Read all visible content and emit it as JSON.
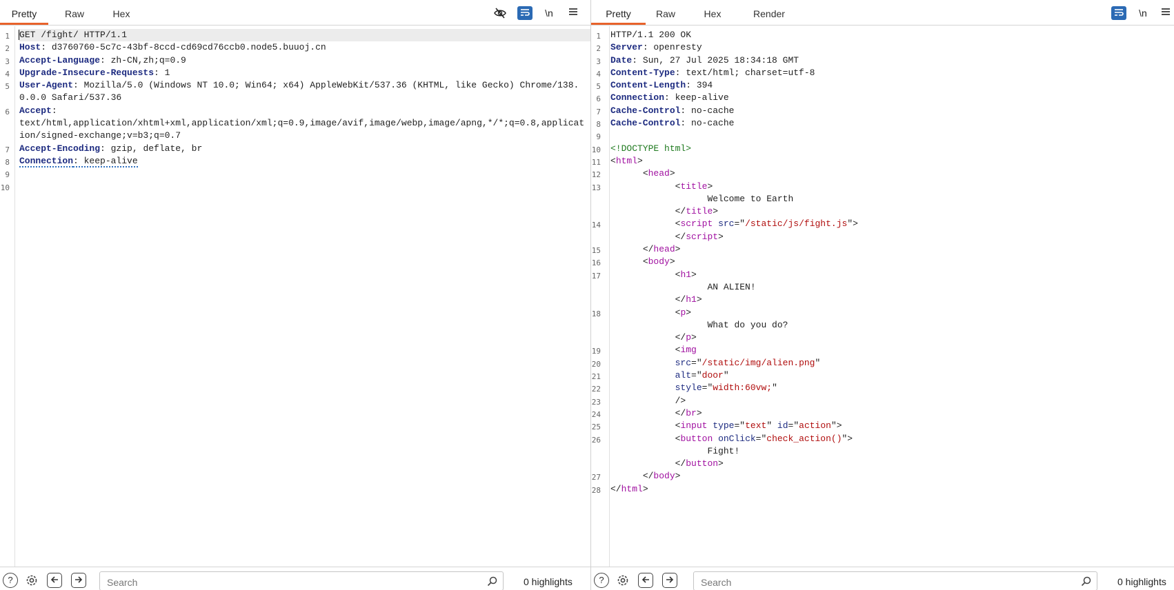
{
  "request_pane": {
    "tabs": [
      {
        "label": "Pretty",
        "active": true
      },
      {
        "label": "Raw",
        "active": false
      },
      {
        "label": "Hex",
        "active": false
      }
    ],
    "toolbar": {
      "hide_icon": "eye-slash-icon",
      "wrap_icon": "wrap-lines-icon",
      "newline_label": "\\n",
      "menu_icon": "hamburger-menu-icon"
    },
    "lines": [
      {
        "n": "1",
        "current": true,
        "tokens": [
          [
            "caret",
            "G"
          ],
          [
            "",
            "ET /fight/ HTTP/1.1"
          ]
        ]
      },
      {
        "n": "2",
        "tokens": [
          [
            "hk",
            "Host"
          ],
          [
            "",
            ": d3760760-5c7c-43bf-8ccd-cd69cd76ccb0.node5.buuoj.cn"
          ]
        ]
      },
      {
        "n": "3",
        "tokens": [
          [
            "hk",
            "Accept-Language"
          ],
          [
            "",
            ": zh-CN,zh;q=0.9"
          ]
        ]
      },
      {
        "n": "4",
        "tokens": [
          [
            "hk",
            "Upgrade-Insecure-Requests"
          ],
          [
            "",
            ": 1"
          ]
        ]
      },
      {
        "n": "5",
        "tokens": [
          [
            "hk",
            "User-Agent"
          ],
          [
            "",
            ": Mozilla/5.0 (Windows NT 10.0; Win64; x64) AppleWebKit/537.36 (KHTML, like Gecko) Chrome/138.0.0.0 Safari/537.36"
          ]
        ]
      },
      {
        "n": "6",
        "tokens": [
          [
            "hk",
            "Accept"
          ],
          [
            "",
            ":\ntext/html,application/xhtml+xml,application/xml;q=0.9,image/avif,image/webp,image/apng,*/*;q=0.8,application/signed-exchange;v=b3;q=0.7"
          ]
        ]
      },
      {
        "n": "7",
        "tokens": [
          [
            "hk",
            "Accept-Encoding"
          ],
          [
            "",
            ": gzip, deflate, br"
          ]
        ]
      },
      {
        "n": "8",
        "tokens": [
          [
            "hk dotted",
            "Connection"
          ],
          [
            "dotted",
            ": keep-alive"
          ]
        ]
      },
      {
        "n": "9",
        "tokens": [
          [
            "",
            ""
          ]
        ]
      },
      {
        "n": "10",
        "tokens": [
          [
            "",
            ""
          ]
        ]
      }
    ],
    "bottom": {
      "help_icon": "help-icon",
      "settings_icon": "gear-icon",
      "back_icon": "arrow-left-icon",
      "forward_icon": "arrow-right-icon",
      "search_placeholder": "Search",
      "search_icon": "search-icon",
      "highlights": "0 highlights"
    }
  },
  "response_pane": {
    "tabs": [
      {
        "label": "Pretty",
        "active": true
      },
      {
        "label": "Raw",
        "active": false
      },
      {
        "label": "Hex",
        "active": false
      },
      {
        "label": "Render",
        "active": false
      }
    ],
    "toolbar": {
      "wrap_icon": "wrap-lines-icon",
      "newline_label": "\\n",
      "menu_icon": "hamburger-menu-icon"
    },
    "lines": [
      {
        "n": "1",
        "tokens": [
          [
            "",
            "HTTP/1.1 200 OK"
          ]
        ]
      },
      {
        "n": "2",
        "tokens": [
          [
            "hk",
            "Server"
          ],
          [
            "",
            ": openresty"
          ]
        ]
      },
      {
        "n": "3",
        "tokens": [
          [
            "hk",
            "Date"
          ],
          [
            "",
            ": Sun, 27 Jul 2025 18:34:18 GMT"
          ]
        ]
      },
      {
        "n": "4",
        "tokens": [
          [
            "hk",
            "Content-Type"
          ],
          [
            "",
            ": text/html; charset=utf-8"
          ]
        ]
      },
      {
        "n": "5",
        "tokens": [
          [
            "hk",
            "Content-Length"
          ],
          [
            "",
            ": 394"
          ]
        ]
      },
      {
        "n": "6",
        "tokens": [
          [
            "hk",
            "Connection"
          ],
          [
            "",
            ": keep-alive"
          ]
        ]
      },
      {
        "n": "7",
        "tokens": [
          [
            "hk",
            "Cache-Control"
          ],
          [
            "",
            ": no-cache"
          ]
        ]
      },
      {
        "n": "8",
        "tokens": [
          [
            "hk",
            "Cache-Control"
          ],
          [
            "",
            ": no-cache"
          ]
        ]
      },
      {
        "n": "9",
        "tokens": [
          [
            "",
            ""
          ]
        ]
      },
      {
        "n": "10",
        "tokens": [
          [
            "dt",
            "<!DOCTYPE html>"
          ]
        ]
      },
      {
        "n": "11",
        "tokens": [
          [
            "",
            "<"
          ],
          [
            "tg",
            "html"
          ],
          [
            "",
            ">"
          ]
        ]
      },
      {
        "n": "12",
        "tokens": [
          [
            "",
            "      <"
          ],
          [
            "tg",
            "head"
          ],
          [
            "",
            ">"
          ]
        ]
      },
      {
        "n": "13",
        "tokens": [
          [
            "",
            "            <"
          ],
          [
            "tg",
            "title"
          ],
          [
            "",
            ">\n                  Welcome to Earth\n            </"
          ],
          [
            "tg",
            "title"
          ],
          [
            "",
            ">"
          ]
        ]
      },
      {
        "n": "14",
        "tokens": [
          [
            "",
            "            <"
          ],
          [
            "tg",
            "script"
          ],
          [
            "",
            " "
          ],
          [
            "at",
            "src"
          ],
          [
            "",
            "=\""
          ],
          [
            "av",
            "/static/js/fight.js"
          ],
          [
            "",
            "\">\n            </"
          ],
          [
            "tg",
            "script"
          ],
          [
            "",
            ">"
          ]
        ]
      },
      {
        "n": "15",
        "tokens": [
          [
            "",
            "      </"
          ],
          [
            "tg",
            "head"
          ],
          [
            "",
            ">"
          ]
        ]
      },
      {
        "n": "16",
        "tokens": [
          [
            "",
            "      <"
          ],
          [
            "tg",
            "body"
          ],
          [
            "",
            ">"
          ]
        ]
      },
      {
        "n": "17",
        "tokens": [
          [
            "",
            "            <"
          ],
          [
            "tg",
            "h1"
          ],
          [
            "",
            ">\n                  AN ALIEN!\n            </"
          ],
          [
            "tg",
            "h1"
          ],
          [
            "",
            ">"
          ]
        ]
      },
      {
        "n": "18",
        "tokens": [
          [
            "",
            "            <"
          ],
          [
            "tg",
            "p"
          ],
          [
            "",
            ">\n                  What do you do?\n            </"
          ],
          [
            "tg",
            "p"
          ],
          [
            "",
            ">"
          ]
        ]
      },
      {
        "n": "19",
        "tokens": [
          [
            "",
            "            <"
          ],
          [
            "tg",
            "img"
          ]
        ]
      },
      {
        "n": "20",
        "tokens": [
          [
            "at",
            "            src"
          ],
          [
            "",
            "=\""
          ],
          [
            "av",
            "/static/img/alien.png"
          ],
          [
            "",
            "\""
          ]
        ]
      },
      {
        "n": "21",
        "tokens": [
          [
            "at",
            "            alt"
          ],
          [
            "",
            "=\""
          ],
          [
            "av",
            "door"
          ],
          [
            "",
            "\""
          ]
        ]
      },
      {
        "n": "22",
        "tokens": [
          [
            "at",
            "            style"
          ],
          [
            "",
            "=\""
          ],
          [
            "av",
            "width:60vw;"
          ],
          [
            "",
            "\""
          ]
        ]
      },
      {
        "n": "23",
        "tokens": [
          [
            "",
            "            />"
          ]
        ]
      },
      {
        "n": "24",
        "tokens": [
          [
            "",
            "            </"
          ],
          [
            "tg",
            "br"
          ],
          [
            "",
            ">"
          ]
        ]
      },
      {
        "n": "25",
        "tokens": [
          [
            "",
            "            <"
          ],
          [
            "tg",
            "input"
          ],
          [
            "",
            " "
          ],
          [
            "at",
            "type"
          ],
          [
            "",
            "=\""
          ],
          [
            "av",
            "text"
          ],
          [
            "",
            "\" "
          ],
          [
            "at",
            "id"
          ],
          [
            "",
            "=\""
          ],
          [
            "av",
            "action"
          ],
          [
            "",
            "\">"
          ]
        ]
      },
      {
        "n": "26",
        "tokens": [
          [
            "",
            "            <"
          ],
          [
            "tg",
            "button"
          ],
          [
            "",
            " "
          ],
          [
            "at",
            "onClick"
          ],
          [
            "",
            "=\""
          ],
          [
            "av",
            "check_action()"
          ],
          [
            "",
            "\">\n                  Fight!\n            </"
          ],
          [
            "tg",
            "button"
          ],
          [
            "",
            ">"
          ]
        ]
      },
      {
        "n": "27",
        "tokens": [
          [
            "",
            "      </"
          ],
          [
            "tg",
            "body"
          ],
          [
            "",
            ">"
          ]
        ]
      },
      {
        "n": "28",
        "tokens": [
          [
            "",
            "</"
          ],
          [
            "tg",
            "html"
          ],
          [
            "",
            ">"
          ]
        ]
      }
    ],
    "bottom": {
      "help_icon": "help-icon",
      "settings_icon": "gear-icon",
      "back_icon": "arrow-left-icon",
      "forward_icon": "arrow-right-icon",
      "search_placeholder": "Search",
      "search_icon": "search-icon",
      "highlights": "0 highlights"
    }
  },
  "colors": {
    "active_tab_underline": "#e8622b",
    "wrap_button_bg": "#2b6ab4",
    "header_key": "#1d2b80",
    "tag": "#a010a0",
    "attr_value": "#b00d0d",
    "doctype": "#1f7a1f"
  }
}
